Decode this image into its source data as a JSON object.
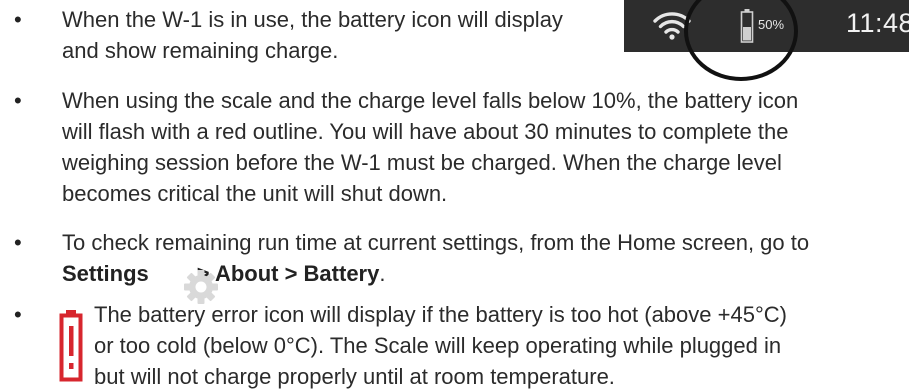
{
  "status_bar": {
    "battery_percent": "50%",
    "time": "11:48",
    "icons": [
      "wifi-icon",
      "battery-icon"
    ]
  },
  "bullets": [
    {
      "lines": [
        "When the W-1 is in use, the battery icon will display",
        "and show remaining charge."
      ]
    },
    {
      "lines": [
        "When using the scale and the charge level falls below 10%, the battery icon",
        "will flash with a red outline. You will have about 30 minutes to complete the",
        "weighing session before the W-1 must be charged. When the charge level",
        "becomes critical the unit will shut down."
      ]
    },
    {
      "line1": "To check remaining run time at current settings, from the Home screen, go to",
      "settings": "Settings",
      "path": "> About > Battery",
      "period": "."
    },
    {
      "lines": [
        "The battery error icon will display if the battery is too hot (above +45°C)",
        "or too cold (below 0°C). The Scale will keep operating while plugged in",
        "but will not charge properly until at room temperature."
      ]
    }
  ],
  "bullet_symbol": "•",
  "colors": {
    "status_bg": "#2d2d2d",
    "error_red": "#d7262e",
    "text": "#2b2b2b"
  }
}
